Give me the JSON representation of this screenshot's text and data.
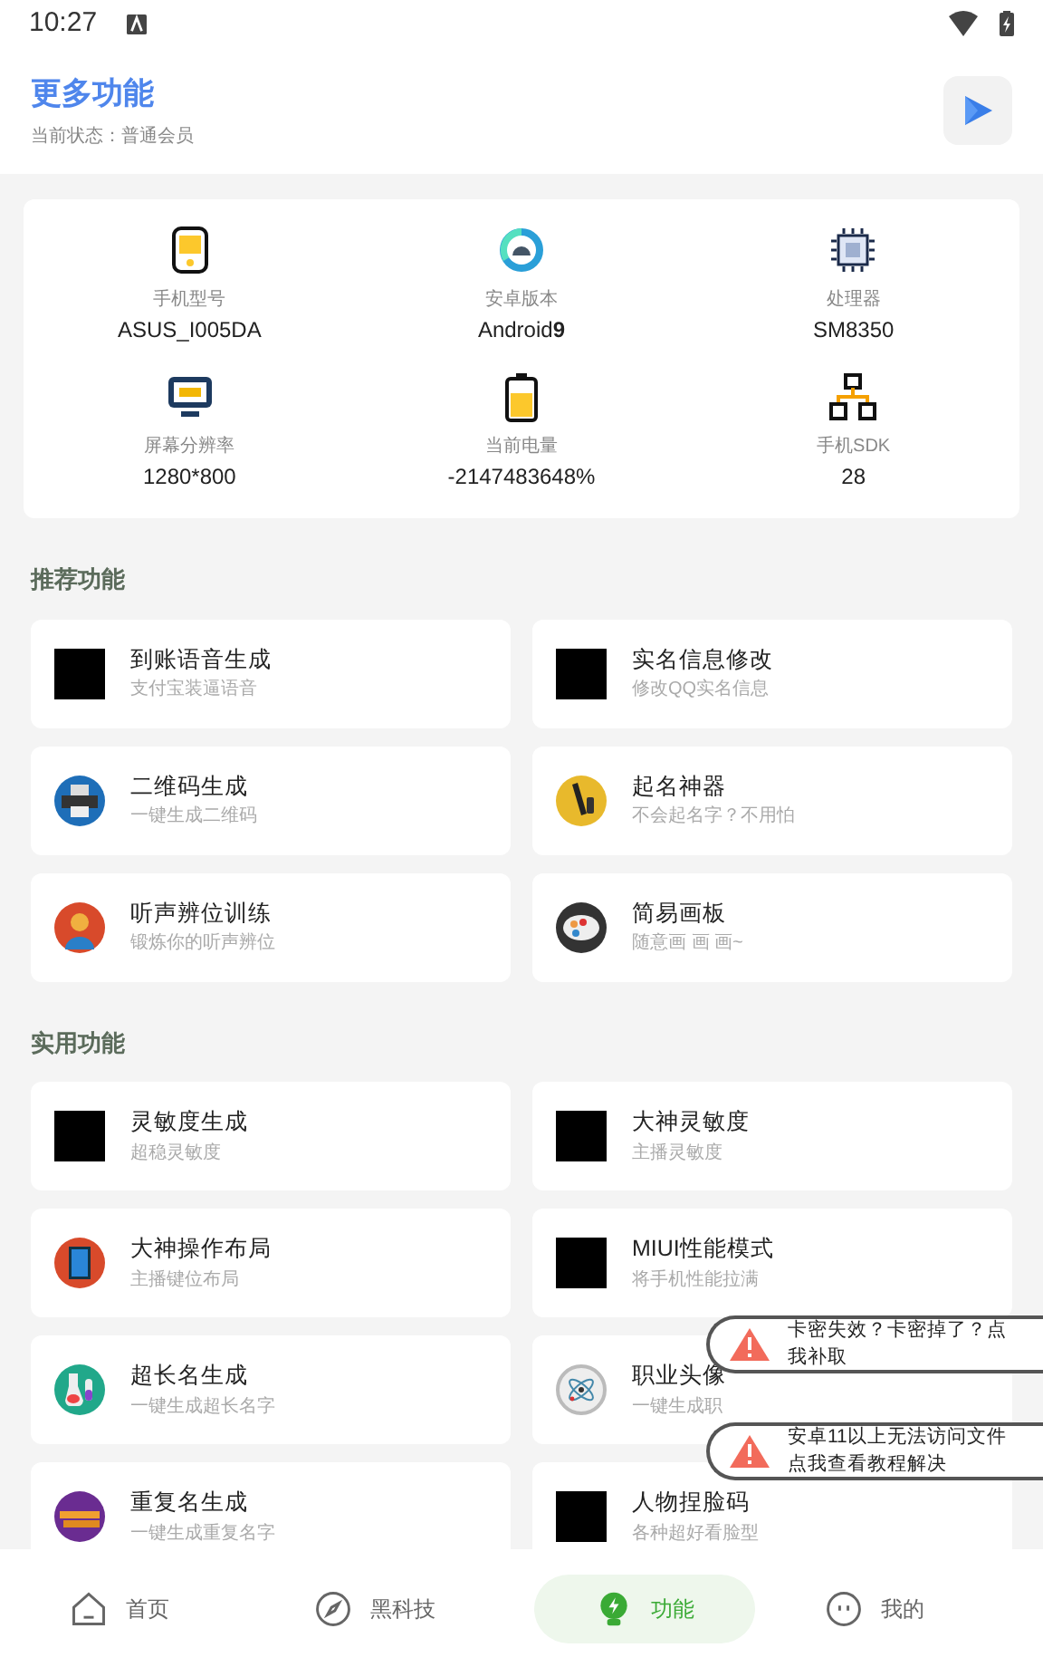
{
  "status_bar": {
    "time": "10:27"
  },
  "header": {
    "title": "更多功能",
    "subtitle": "当前状态：普通会员"
  },
  "device_info": [
    {
      "kind": "phone",
      "label": "手机型号",
      "value": "ASUS_I005DA"
    },
    {
      "kind": "android",
      "label": "安卓版本",
      "value": "Android**9**"
    },
    {
      "kind": "chip",
      "label": "处理器",
      "value": "SM8350"
    },
    {
      "kind": "screen",
      "label": "屏幕分辨率",
      "value": "1280*800"
    },
    {
      "kind": "battery",
      "label": "当前电量",
      "value": "-2147483648%"
    },
    {
      "kind": "sdk",
      "label": "手机SDK",
      "value": "28"
    }
  ],
  "sections": [
    {
      "title": "推荐功能",
      "items": [
        {
          "kind": "black",
          "title": "到账语音生成",
          "subtitle": "支付宝装逼语音"
        },
        {
          "kind": "black",
          "title": "实名信息修改",
          "subtitle": "修改QQ实名信息"
        },
        {
          "kind": "qr",
          "title": "二维码生成",
          "subtitle": "一键生成二维码"
        },
        {
          "kind": "pen",
          "title": "起名神器",
          "subtitle": "不会起名字？不用怕"
        },
        {
          "kind": "person",
          "title": "听声辨位训练",
          "subtitle": "锻炼你的听声辨位"
        },
        {
          "kind": "palette",
          "title": "简易画板",
          "subtitle": "随意画 画 画~"
        }
      ]
    },
    {
      "title": "实用功能",
      "items": [
        {
          "kind": "black",
          "title": "灵敏度生成",
          "subtitle": "超稳灵敏度"
        },
        {
          "kind": "black",
          "title": "大神灵敏度",
          "subtitle": "主播灵敏度"
        },
        {
          "kind": "tablet",
          "title": "大神操作布局",
          "subtitle": "主播键位布局"
        },
        {
          "kind": "black",
          "title": "MIUI性能模式",
          "subtitle": "将手机性能拉满"
        },
        {
          "kind": "flask",
          "title": "超长名生成",
          "subtitle": "一键生成超长名字"
        },
        {
          "kind": "atom",
          "title": "职业头像",
          "subtitle": "一键生成职"
        },
        {
          "kind": "bars",
          "title": "重复名生成",
          "subtitle": "一键生成重复名字"
        },
        {
          "kind": "black",
          "title": "人物捏脸码",
          "subtitle": "各种超好看脸型"
        }
      ]
    }
  ],
  "toasts": [
    {
      "text": "卡密失效？卡密掉了？点我补取"
    },
    {
      "text": "安卓11以上无法访问文件点我查看教程解决"
    }
  ],
  "bottom_nav": [
    {
      "kind": "home",
      "label": "首页",
      "selected": false
    },
    {
      "kind": "compass",
      "label": "黑科技",
      "selected": false
    },
    {
      "kind": "bulb",
      "label": "功能",
      "selected": true
    },
    {
      "kind": "face",
      "label": "我的",
      "selected": false
    }
  ]
}
